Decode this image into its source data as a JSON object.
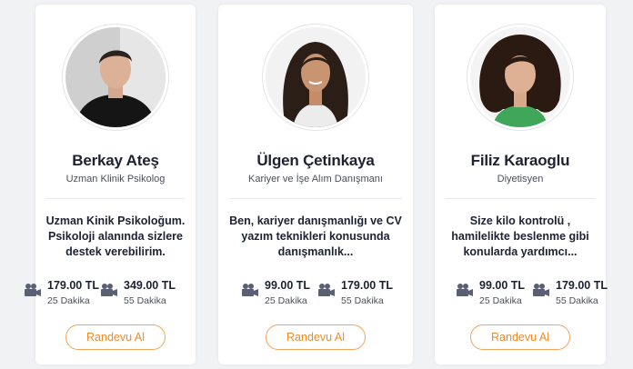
{
  "accent_color": "#ef8a2b",
  "cards": [
    {
      "name": "Berkay Ateş",
      "title": "Uzman Klinik Psikolog",
      "description": "Uzman Kinik Psikoloğum. Psikoloji alanında sizlere destek verebilirim.",
      "prices": [
        {
          "icon": "video-camera-icon",
          "amount": "179.00 TL",
          "duration": "25 Dakika"
        },
        {
          "icon": "video-camera-icon",
          "amount": "349.00 TL",
          "duration": "55 Dakika"
        }
      ],
      "button_label": "Randevu Al"
    },
    {
      "name": "Ülgen Çetinkaya",
      "title": "Kariyer ve İşe Alım Danışmanı",
      "description": "Ben, kariyer danışmanlığı ve CV yazım teknikleri konusunda danışmanlık...",
      "prices": [
        {
          "icon": "video-camera-icon",
          "amount": "99.00 TL",
          "duration": "25 Dakika"
        },
        {
          "icon": "video-camera-icon",
          "amount": "179.00 TL",
          "duration": "55 Dakika"
        }
      ],
      "button_label": "Randevu Al"
    },
    {
      "name": "Filiz Karaoglu",
      "title": "Diyetisyen",
      "description": "Size kilo kontrolü , hamilelikte beslenme gibi konularda yardımcı...",
      "prices": [
        {
          "icon": "video-camera-icon",
          "amount": "99.00 TL",
          "duration": "25 Dakika"
        },
        {
          "icon": "video-camera-icon",
          "amount": "179.00 TL",
          "duration": "55 Dakika"
        }
      ],
      "button_label": "Randevu Al"
    }
  ]
}
